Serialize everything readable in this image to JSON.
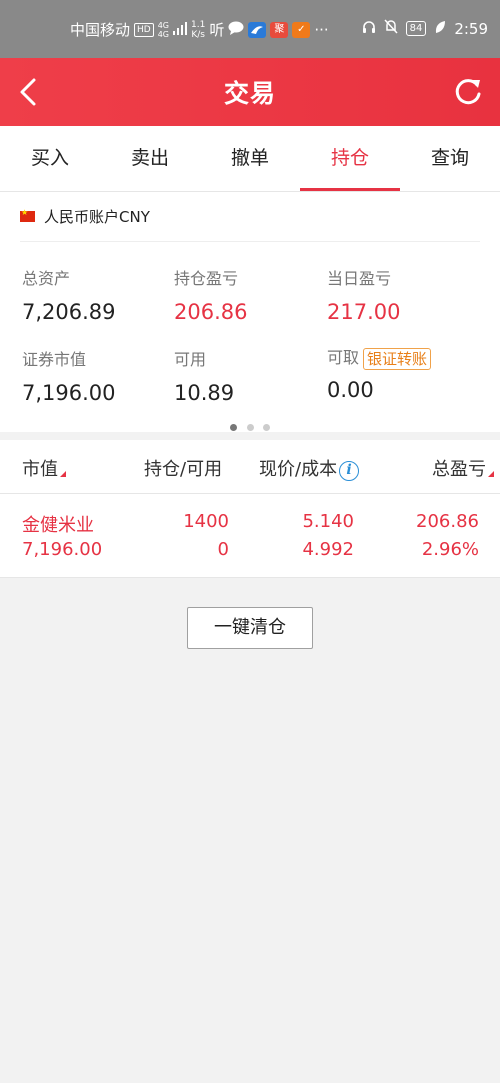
{
  "status_bar": {
    "carrier": "中国移动",
    "hd": "HD",
    "signal_top": "4G",
    "signal_bottom": "4G",
    "speed_top": "1.1",
    "speed_bottom": "K/s",
    "ting": "听",
    "app_icon_3": "聚",
    "app_icon_4": "✓",
    "more": "···",
    "battery": "84",
    "time": "2:59"
  },
  "header": {
    "title": "交易"
  },
  "tabs": [
    {
      "label": "买入"
    },
    {
      "label": "卖出"
    },
    {
      "label": "撤单"
    },
    {
      "label": "持仓"
    },
    {
      "label": "查询"
    }
  ],
  "account": {
    "label": "人民币账户CNY",
    "stats": [
      {
        "label": "总资产",
        "value": "7,206.89"
      },
      {
        "label": "持仓盈亏",
        "value": "206.86"
      },
      {
        "label": "当日盈亏",
        "value": "217.00"
      },
      {
        "label": "证券市值",
        "value": "7,196.00"
      },
      {
        "label": "可用",
        "value": "10.89"
      },
      {
        "label": "可取",
        "value": "0.00"
      }
    ],
    "transfer_label": "银证转账"
  },
  "table": {
    "headers": [
      "市值",
      "持仓/可用",
      "现价/成本",
      "总盈亏"
    ],
    "rows": [
      {
        "name": "金健米业",
        "market_value": "7,196.00",
        "position": "1400",
        "available": "0",
        "price": "5.140",
        "cost": "4.992",
        "profit": "206.86",
        "profit_pct": "2.96%"
      }
    ]
  },
  "clear_button": "一键清仓",
  "colors": {
    "accent": "#e63344",
    "header": "#ef3e49",
    "transfer": "#e8801a",
    "info": "#2b8fd6"
  }
}
